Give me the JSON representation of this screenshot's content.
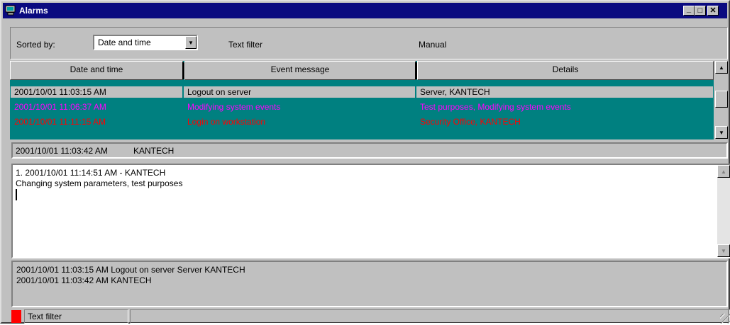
{
  "window": {
    "title": "Alarms",
    "controls": {
      "minimize": "_",
      "maximize": "□",
      "close": "✕"
    }
  },
  "toolbar": {
    "sorted_by_label": "Sorted by:",
    "sorted_by_value": "Date and time",
    "text_filter_label": "Text filter",
    "manual_label": "Manual"
  },
  "grid": {
    "columns": [
      "Date and time",
      "Event message",
      "Details"
    ],
    "rows": [
      {
        "date": "2001/10/01 11:03:15 AM",
        "event": "Logout on server",
        "details": "Server, KANTECH",
        "color": "#000000",
        "selected": true
      },
      {
        "date": "2001/10/01 11:06:37 AM",
        "event": "Modifying system events",
        "details": "Test purposes, Modifying system events",
        "color": "#ff00ff",
        "selected": false
      },
      {
        "date": "2001/10/01 11:11:15 AM",
        "event": "Login on workstation",
        "details": "Security Office, KANTECH",
        "color": "#ff0000",
        "selected": false
      }
    ]
  },
  "status_line": {
    "datetime": "2001/10/01 11:03:42 AM",
    "user": "KANTECH"
  },
  "memo": {
    "lines": [
      "1. 2001/10/01 11:14:51 AM - KANTECH",
      "Changing system parameters, test purposes"
    ]
  },
  "log": {
    "lines": [
      "2001/10/01 11:03:15 AM  Logout on server  Server KANTECH",
      "2001/10/01 11:03:42 AM    KANTECH"
    ]
  },
  "statusbar": {
    "indicator_color": "#ff0000",
    "filter_label": "Text filter"
  },
  "colors": {
    "title_bar": "#0a0a80",
    "grid_background": "#008080",
    "window_face": "#c0c0c0"
  }
}
